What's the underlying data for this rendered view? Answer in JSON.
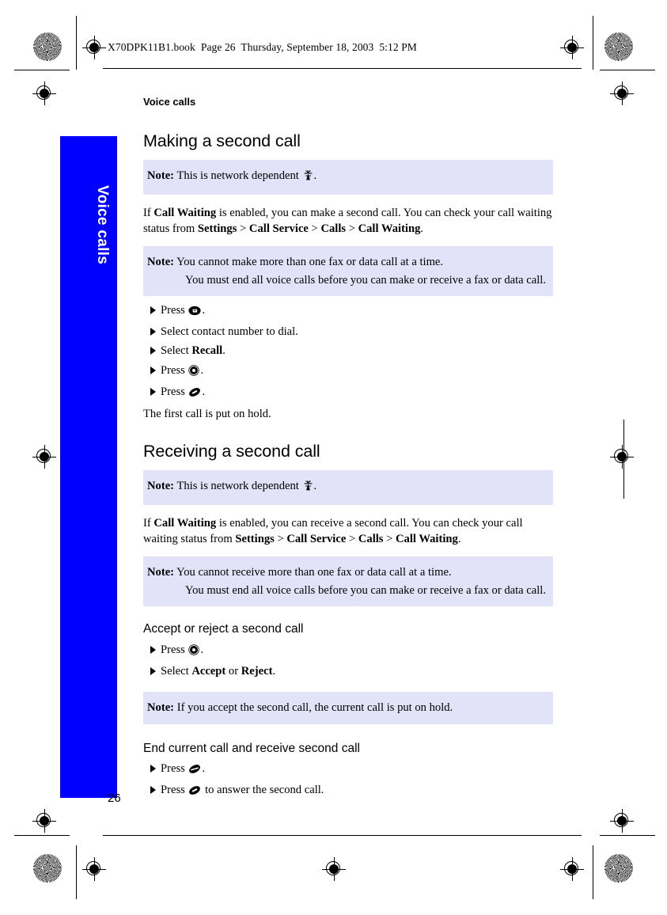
{
  "doc_stamp": "X70DPK11B1.book  Page 26  Thursday, September 18, 2003  5:12 PM",
  "side_tab": {
    "label": "Voice calls",
    "color": "#0000ff",
    "text_color": "#ffffff"
  },
  "running_head": "Voice calls",
  "page_number": "26",
  "note_bg_color": "#e2e2f8",
  "sections": {
    "making": {
      "title": "Making a second call",
      "note1": {
        "label": "Note:",
        "text": "This is network dependent",
        "icon": "network-antenna-icon",
        "trailing": "."
      },
      "paragraph": {
        "p1": "If ",
        "b1": "Call Waiting",
        "p2": " is enabled, you can make a second call. You can check your call waiting status from ",
        "b2": "Settings",
        "sep1": " > ",
        "b3": "Call Service",
        "sep2": " > ",
        "b4": "Calls",
        "sep3": " > ",
        "b5": "Call Waiting",
        "p3": "."
      },
      "note2": {
        "label": "Note:",
        "line1": "You cannot make more than one fax or data call at a time.",
        "line2": "You must end all voice calls before you can make or receive a fax or data call."
      },
      "steps": [
        {
          "pre": "Press ",
          "icon": "call-send-key-icon",
          "post": "."
        },
        {
          "pre": "Select contact number to dial.",
          "icon": "",
          "post": ""
        },
        {
          "pre": "Select ",
          "bold": "Recall",
          "icon": "",
          "post": "."
        },
        {
          "pre": "Press ",
          "icon": "ok-select-key-icon",
          "post": "."
        },
        {
          "pre": "Press ",
          "icon": "end-call-key-icon",
          "post": "."
        }
      ],
      "trailing": "The first call is put on hold."
    },
    "receiving": {
      "title": "Receiving a second call",
      "note1": {
        "label": "Note:",
        "text": "This is network dependent",
        "icon": "network-antenna-icon",
        "trailing": "."
      },
      "paragraph": {
        "p1": "If ",
        "b1": "Call Waiting",
        "p2": " is enabled, you can receive a second call. You can check your call waiting status from ",
        "b2": "Settings",
        "sep1": " > ",
        "b3": "Call Service",
        "sep2": " > ",
        "b4": "Calls",
        "sep3": " > ",
        "b5": "Call Waiting",
        "p3": "."
      },
      "note2": {
        "label": "Note:",
        "line1": "You cannot receive more than one fax or data call at a time.",
        "line2": "You must end all voice calls before you can make or receive a fax or data call."
      }
    },
    "accept_reject": {
      "title": "Accept or reject a second call",
      "steps": [
        {
          "pre": "Press ",
          "icon": "ok-select-key-icon",
          "post": "."
        },
        {
          "pre": "Select ",
          "bold": "Accept",
          "mid": " or ",
          "bold2": "Reject",
          "post": "."
        }
      ],
      "note": {
        "label": "Note:",
        "text": "If you accept the second call, the current call is put on hold."
      }
    },
    "end_current": {
      "title": "End current call and receive second call",
      "steps": [
        {
          "pre": "Press ",
          "icon": "end-call-slash-key-icon",
          "post": "."
        },
        {
          "pre": "Press ",
          "icon": "end-call-key-icon",
          "post": " to answer the second call."
        }
      ]
    }
  }
}
